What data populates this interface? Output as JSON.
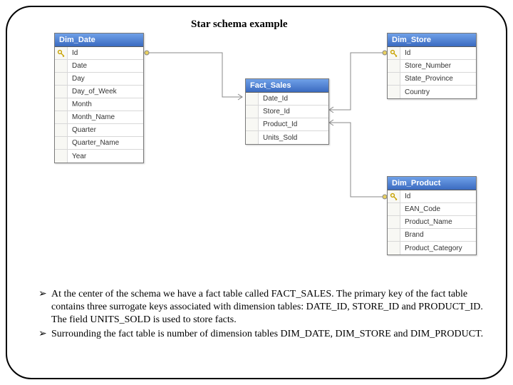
{
  "title": "Star schema example",
  "tables": {
    "dim_date": {
      "name": "Dim_Date",
      "fields": [
        "Id",
        "Date",
        "Day",
        "Day_of_Week",
        "Month",
        "Month_Name",
        "Quarter",
        "Quarter_Name",
        "Year"
      ]
    },
    "fact_sales": {
      "name": "Fact_Sales",
      "fields": [
        "Date_Id",
        "Store_Id",
        "Product_Id",
        "Units_Sold"
      ]
    },
    "dim_store": {
      "name": "Dim_Store",
      "fields": [
        "Id",
        "Store_Number",
        "State_Province",
        "Country"
      ]
    },
    "dim_product": {
      "name": "Dim_Product",
      "fields": [
        "Id",
        "EAN_Code",
        "Product_Name",
        "Brand",
        "Product_Category"
      ]
    }
  },
  "bullets": [
    "At the center of the schema we have a fact table called FACT_SALES. The primary key of the fact table contains three surrogate keys associated with dimension tables: DATE_ID, STORE_ID and PRODUCT_ID. The field UNITS_SOLD is used to store facts.",
    "Surrounding the fact table is number of dimension tables DIM_DATE, DIM_STORE and DIM_PRODUCT."
  ],
  "icons": {
    "key": "key-icon"
  }
}
